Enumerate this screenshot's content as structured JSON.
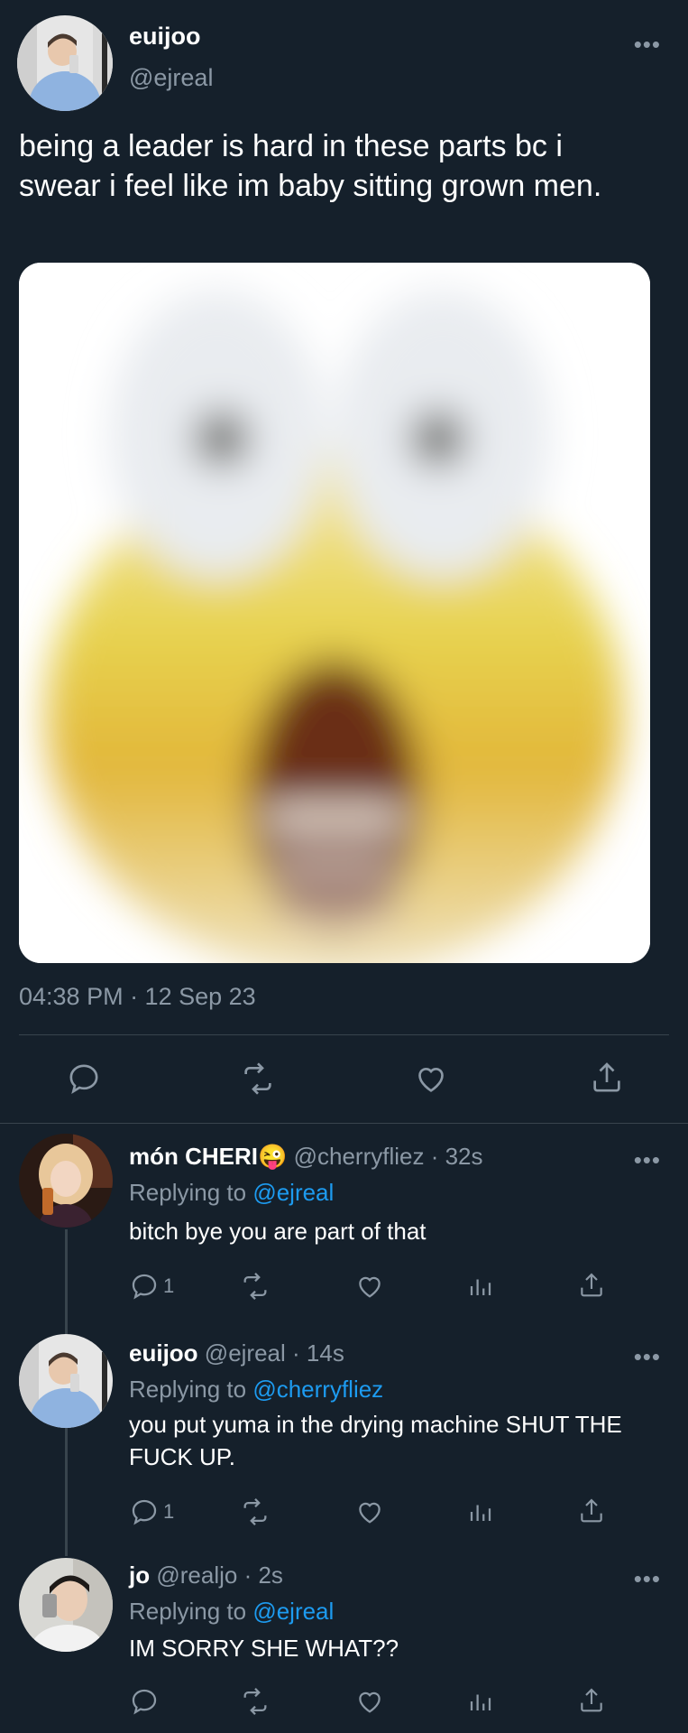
{
  "main_tweet": {
    "display_name": "euijoo",
    "handle": "@ejreal",
    "more_icon": "more-dots-icon",
    "text": "being a leader is hard in these parts bc i swear i feel like im baby sitting grown men.",
    "timestamp": "04:38 PM · 12 Sep 23",
    "actions": [
      "reply-icon",
      "retweet-icon",
      "like-icon",
      "share-icon"
    ]
  },
  "replies": [
    {
      "display_name": "món CHERI😜",
      "handle": "@cherryfliez",
      "time": "· 32s",
      "replying_prefix": "Replying to ",
      "replying_to": "@ejreal",
      "text": "bitch bye you are part of that",
      "reply_count": "1"
    },
    {
      "display_name": "euijoo",
      "handle": "@ejreal",
      "time": "· 14s",
      "replying_prefix": "Replying to ",
      "replying_to": "@cherryfliez",
      "text": "you put yuma in the drying machine SHUT THE FUCK UP.",
      "reply_count": "1"
    },
    {
      "display_name": "jo",
      "handle": "@realjo",
      "time": "· 2s",
      "replying_prefix": "Replying to ",
      "replying_to": "@ejreal",
      "text": "IM SORRY SHE WHAT??",
      "reply_count": ""
    }
  ],
  "colors": {
    "background": "#15202b",
    "text": "#ffffff",
    "muted": "#8b98a5",
    "link": "#1d9bf0",
    "divider": "#38444d"
  }
}
